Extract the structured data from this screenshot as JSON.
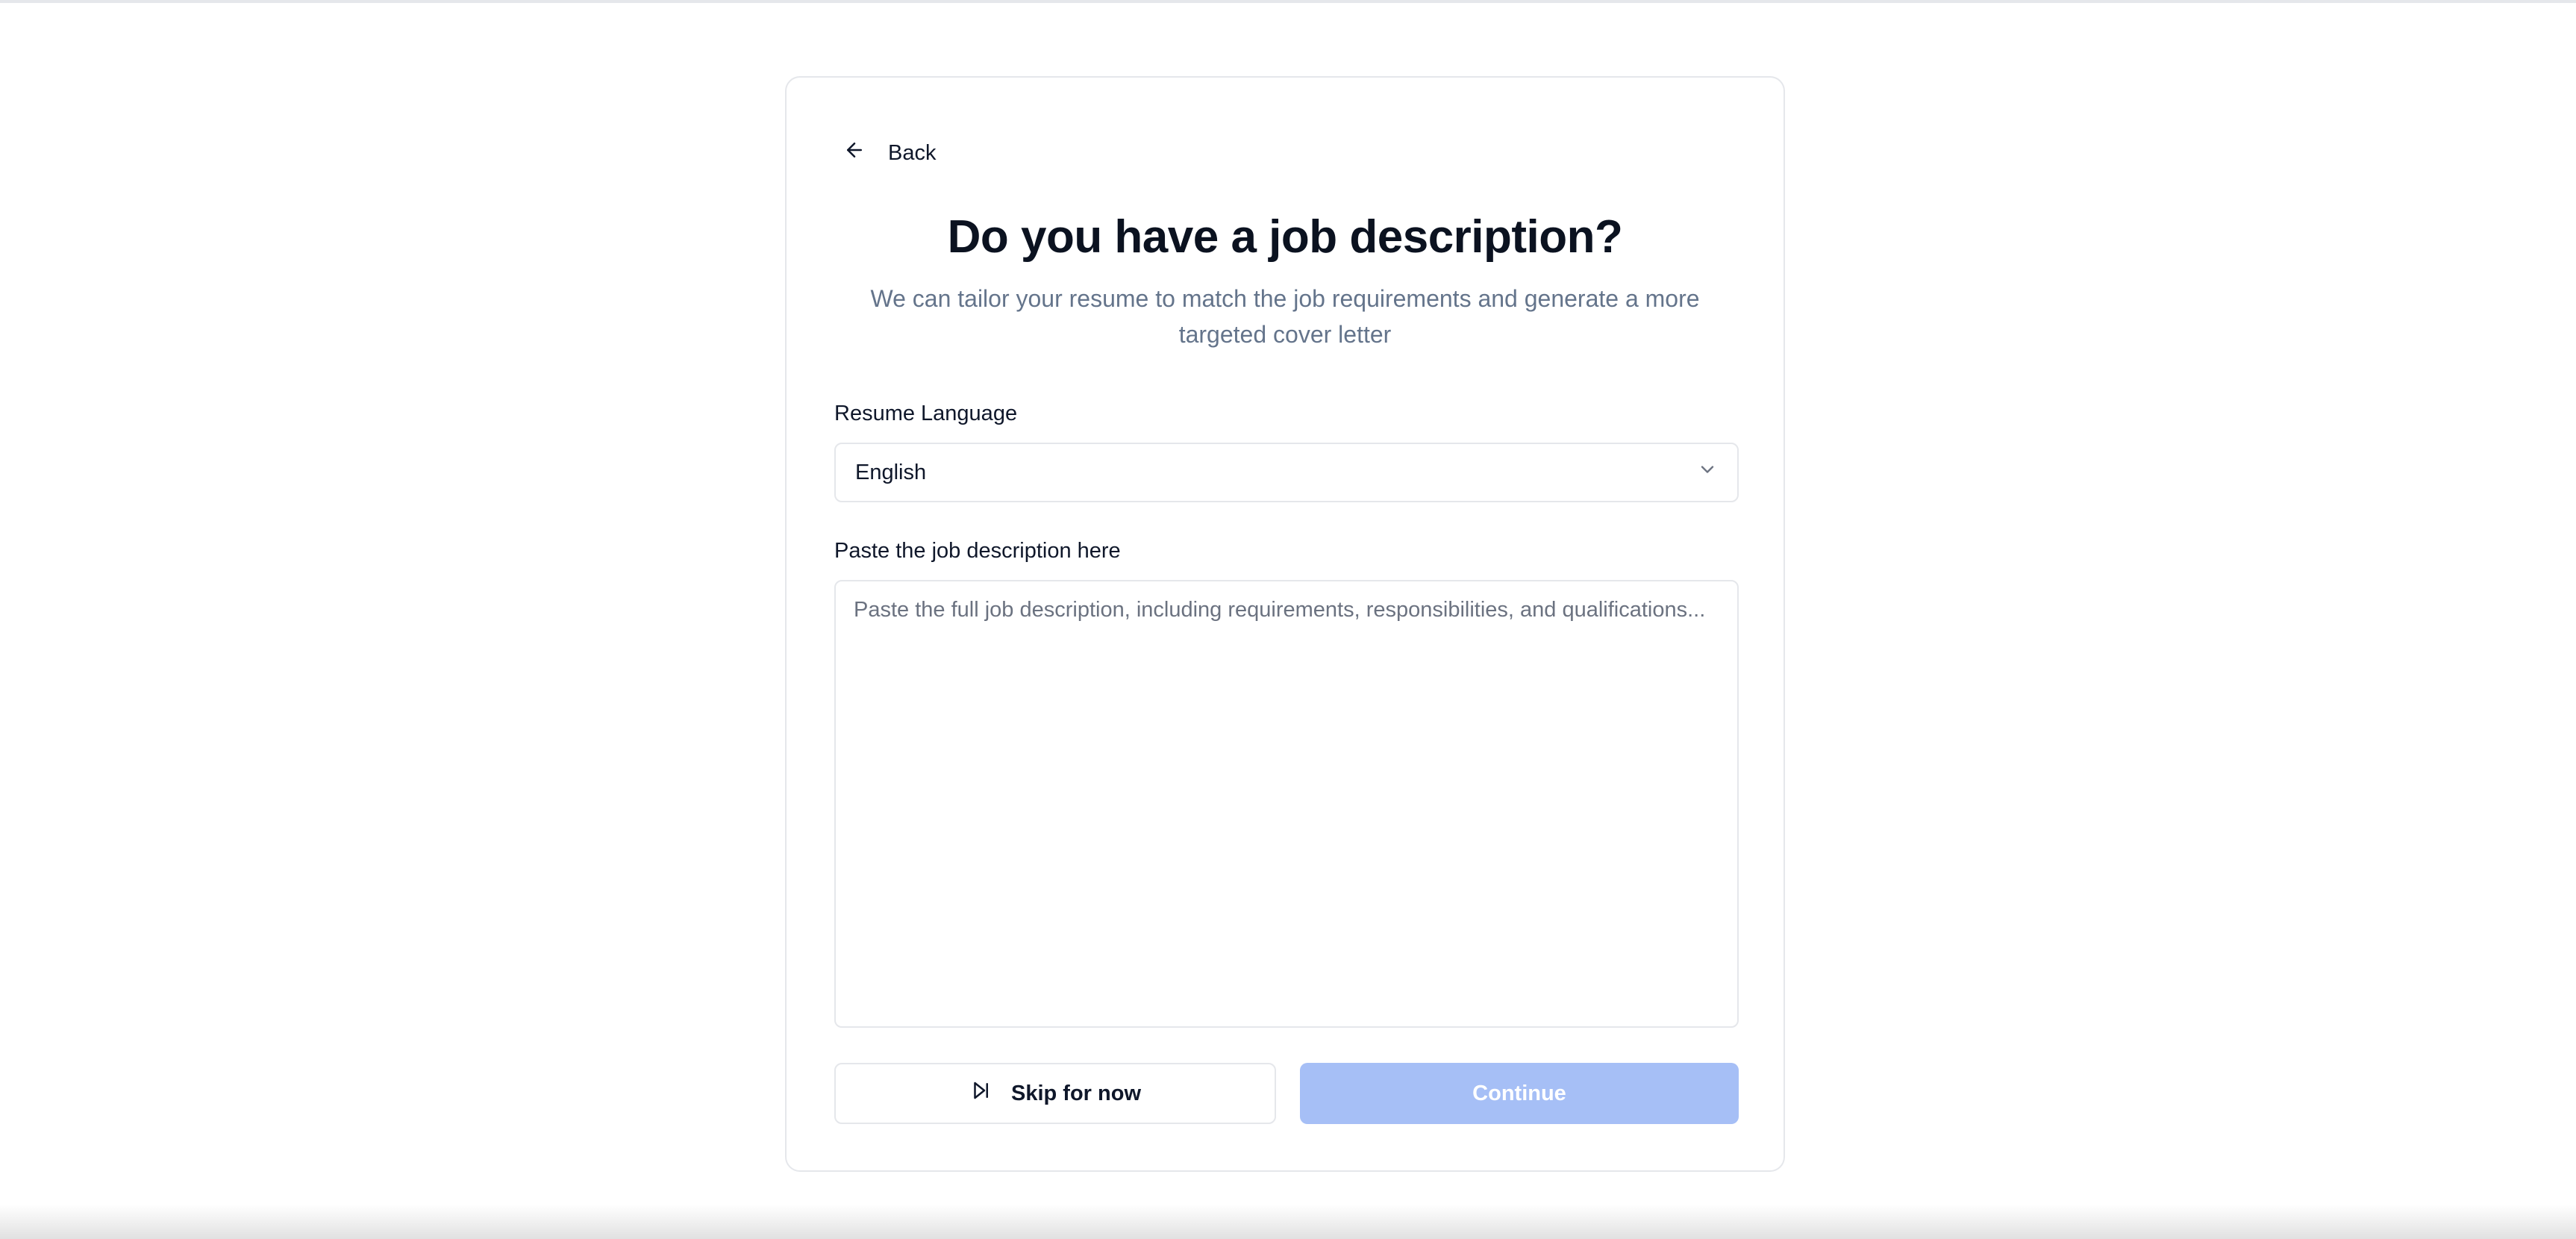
{
  "nav": {
    "back_label": "Back",
    "back_icon": "arrow-left-icon"
  },
  "page": {
    "title": "Do you have a job description?",
    "subtitle": "We can tailor your resume to match the job requirements and generate a more targeted cover letter"
  },
  "language": {
    "label": "Resume Language",
    "selected": "English",
    "icon": "chevron-down-icon"
  },
  "job_description": {
    "label": "Paste the job description here",
    "value": "",
    "placeholder": "Paste the full job description, including requirements, responsibilities, and qualifications..."
  },
  "actions": {
    "skip_label": "Skip for now",
    "skip_icon": "skip-forward-icon",
    "continue_label": "Continue",
    "continue_disabled": true
  },
  "colors": {
    "continue_disabled_bg": "#a6bff6",
    "subtitle_text": "#64748b",
    "border": "#e5e7eb"
  }
}
